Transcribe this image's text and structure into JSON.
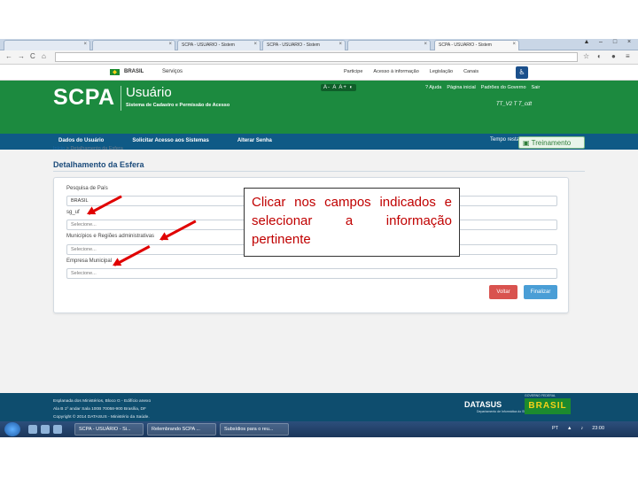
{
  "browser": {
    "tabs": [
      {
        "label": ""
      },
      {
        "label": ""
      },
      {
        "label": "SCPA - USUARIO - Sistem"
      },
      {
        "label": "SCPA - USUARIO - Sistem"
      },
      {
        "label": ""
      },
      {
        "label": "SCPA - USUARIO - Sistem"
      }
    ],
    "url": ""
  },
  "govbar": {
    "brasil": "BRASIL",
    "servicos": "Serviços",
    "participe": "Participe",
    "acesso_info": "Acesso à informação",
    "legislacao": "Legislação",
    "canais": "Canais"
  },
  "header": {
    "logo": "SCPA",
    "subtitle": "Usuário",
    "description": "Sistema de Cadastro e Permissão de Acesso",
    "font_controls": "A- A A+ ◐",
    "links": [
      "? Ajuda",
      "Página inicial",
      "Padrões do Governo",
      "Sair"
    ],
    "user": "TT_V2 T T_cdt"
  },
  "menu": {
    "items": [
      "Dados do Usuário",
      "Solicitar Acesso aos Sistemas",
      "Alterar Senha"
    ],
    "timer": "Tempo restante: 19 min 52 seg",
    "treinamento": "Treinamento"
  },
  "content": {
    "breadcrumb_home": "Início",
    "breadcrumb_sep": " > ",
    "breadcrumb_current": "Detalhamento da Esfera",
    "title": "Detalhamento da Esfera",
    "fields": [
      {
        "label": "Pesquisa de País",
        "value": "BRASIL"
      },
      {
        "label": "sg_uf",
        "value": "Selecione..."
      },
      {
        "label": "Municípios e Regiões administrativas",
        "value": "Selecione..."
      },
      {
        "label": "Empresa Municipal",
        "value": "Selecione..."
      }
    ],
    "btn_voltar": "Voltar",
    "btn_finalizar": "Finalizar"
  },
  "callout": {
    "text": "Clicar nos campos indicados e selecionar a informação pertinente"
  },
  "footer": {
    "line1": "Esplanada dos Ministérios, Bloco G - Edifício anexo",
    "line2": "Ala B  1º andar  Sala 100B  70058-900  Brasília, DF",
    "line3": "Copyright © 2014 DATASUS - Ministério da Saúde.",
    "datasus": "DATASUS",
    "datasus_sub": "Departamento de Informática do SUS",
    "brasil": "BRASIL",
    "brasil_sub": "GOVERNO FEDERAL"
  },
  "taskbar": {
    "tasks": [
      "SCPA - USUÁRIO - Si...",
      "Relembrando SCPA ...",
      "Subsídios para o reu..."
    ],
    "lang": "PT",
    "time": "23:00"
  },
  "colors": {
    "header_green": "#1c8a3f",
    "menu_blue": "#0f5a86",
    "callout_red": "#c00000",
    "voltar_red": "#d9534f",
    "finalizar_blue": "#4a9ed6"
  }
}
